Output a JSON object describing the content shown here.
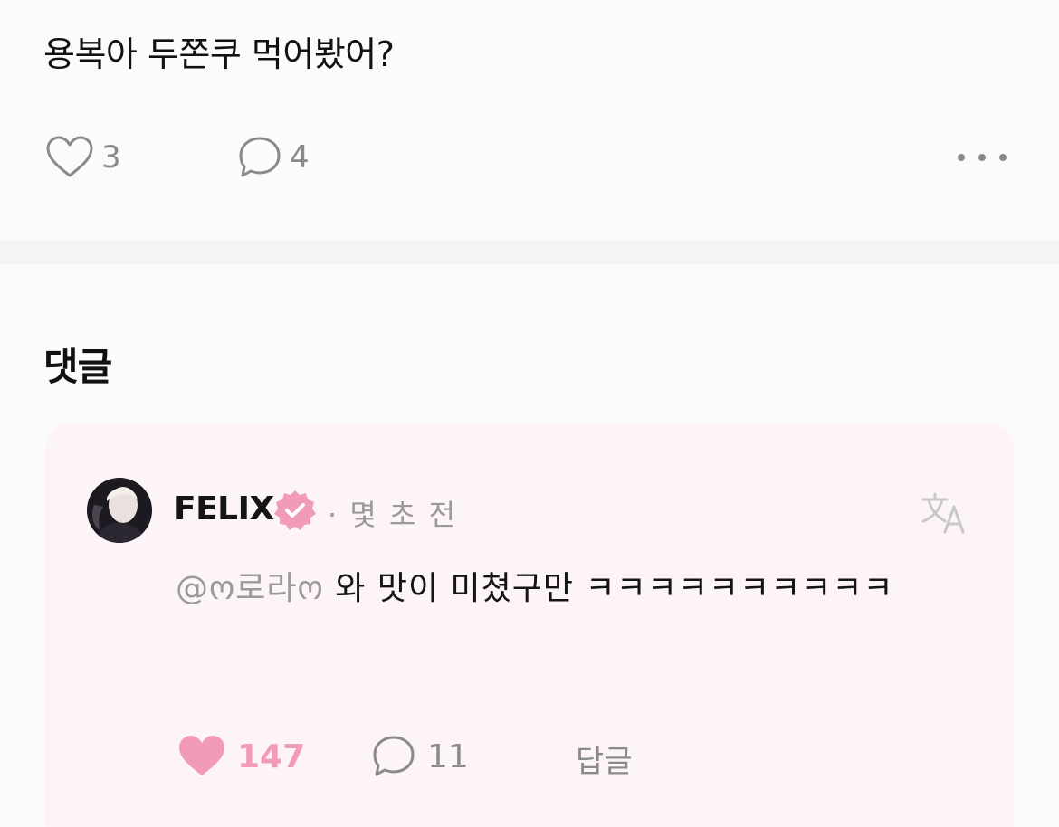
{
  "post": {
    "text": "용복아 두쫀쿠 먹어봤어?",
    "like_count": "3",
    "comment_count": "4",
    "more_icon": "more-horizontal-icon"
  },
  "comments_section": {
    "title": "댓글"
  },
  "comment": {
    "username": "FELIX",
    "time": "· 몇 초 전",
    "mention": "@ო로라ო",
    "text": " 와 맛이 미쳤구만 ㅋㅋㅋㅋㅋㅋㅋㅋㅋㅋ",
    "like_count": "147",
    "comment_count": "11",
    "reply_label": "답글",
    "icons": {
      "avatar": "avatar",
      "verified": "verified-badge-icon",
      "translate": "translate-icon",
      "like": "heart-filled-icon",
      "comment": "speech-bubble-icon"
    }
  },
  "colors": {
    "background": "#fbfbfd",
    "card_background": "#fdf4f7",
    "accent_pink": "#f19bb8",
    "muted_text": "#8a8a8a"
  }
}
